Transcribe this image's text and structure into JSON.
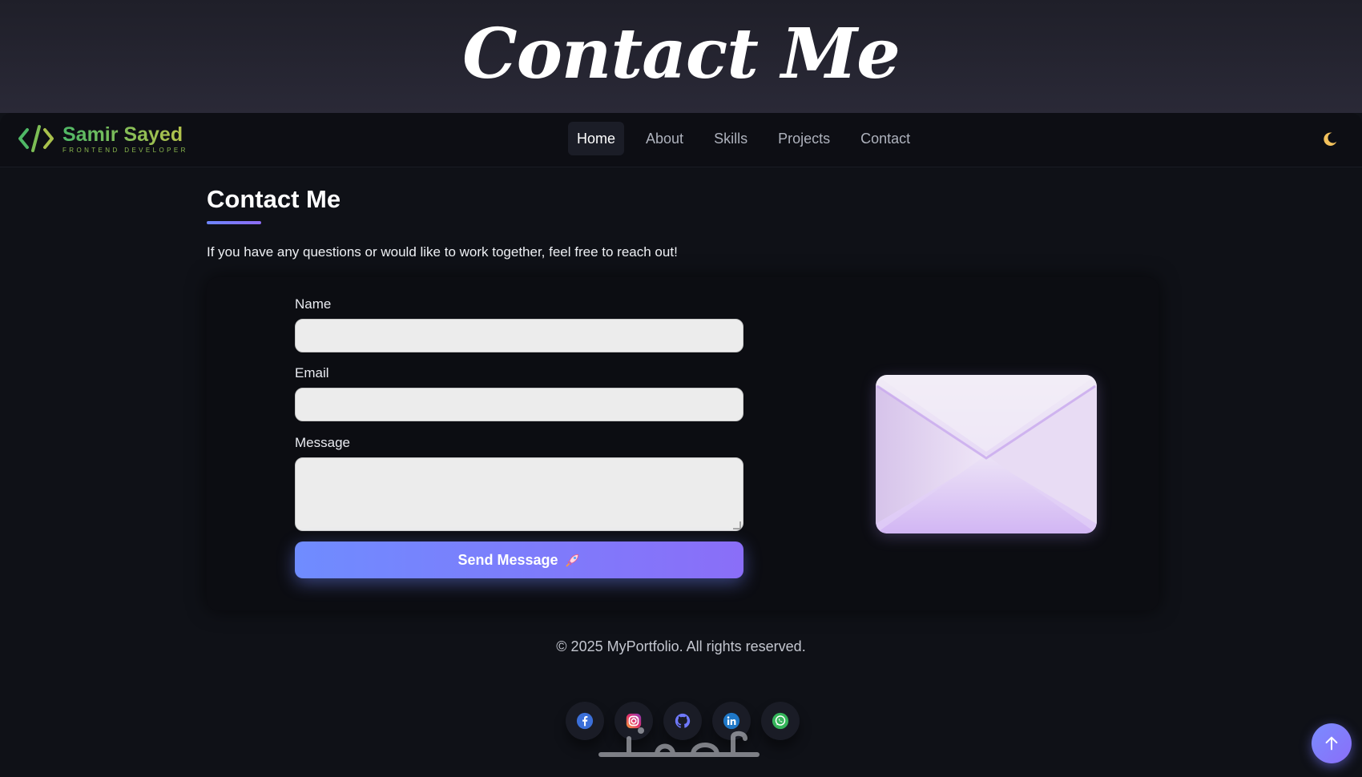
{
  "hero": {
    "title": "Contact Me"
  },
  "brand": {
    "name": "Samir Sayed",
    "subtitle": "FRONTEND DEVELOPER",
    "icon": "code-brackets-icon"
  },
  "nav": {
    "items": [
      {
        "label": "Home",
        "active": true
      },
      {
        "label": "About",
        "active": false
      },
      {
        "label": "Skills",
        "active": false
      },
      {
        "label": "Projects",
        "active": false
      },
      {
        "label": "Contact",
        "active": false
      }
    ],
    "theme_toggle_icon": "moon-icon"
  },
  "contact": {
    "title": "Contact Me",
    "intro": "If you have any questions or would like to work together, feel free to reach out!",
    "form": {
      "name_label": "Name",
      "name_value": "",
      "email_label": "Email",
      "email_value": "",
      "message_label": "Message",
      "message_value": "",
      "submit_label": "Send Message",
      "submit_icon": "rocket-icon"
    },
    "illustration": "envelope-icon"
  },
  "footer": {
    "copyright": "© 2025 MyPortfolio. All rights reserved.",
    "socials": [
      "facebook-icon",
      "instagram-icon",
      "github-icon",
      "linkedin-icon",
      "whatsapp-icon"
    ]
  },
  "colors": {
    "background": "#0f1117",
    "accent_start": "#6f8cff",
    "accent_end": "#8a6ef8",
    "brand_green": "#4fb866"
  }
}
